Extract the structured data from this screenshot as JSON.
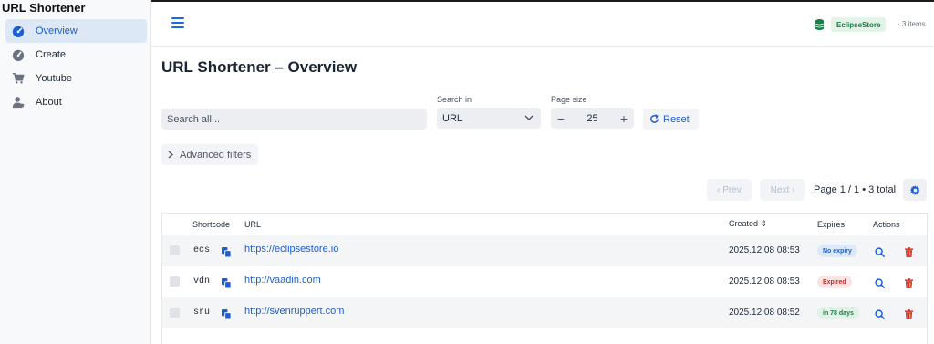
{
  "app": {
    "title": "URL Shortener"
  },
  "sidebar": {
    "items": [
      {
        "label": "Overview",
        "icon": "dashboard-icon",
        "active": true
      },
      {
        "label": "Create",
        "icon": "gauge-icon"
      },
      {
        "label": "Youtube",
        "icon": "cart-icon"
      },
      {
        "label": "About",
        "icon": "user-icon"
      }
    ]
  },
  "header": {
    "store_label": "EclipseStore",
    "items_count": "· 3 items"
  },
  "main": {
    "title": "URL Shortener – Overview"
  },
  "filters": {
    "search_placeholder": "Search all...",
    "search_in_label": "Search in",
    "search_in_value": "URL",
    "page_size_label": "Page size",
    "page_size_value": "25",
    "minus": "−",
    "plus": "+",
    "reset_label": "Reset",
    "advanced_label": "Advanced filters"
  },
  "pagination": {
    "prev_label": "‹ Prev",
    "next_label": "Next ›",
    "info": "Page 1 / 1 • 3 total"
  },
  "table": {
    "headers": {
      "shortcode": "Shortcode",
      "url": "URL",
      "created": "Created ⇕",
      "expires": "Expires",
      "actions": "Actions"
    },
    "rows": [
      {
        "shortcode": "ecs",
        "url": "https://eclipsestore.io",
        "created": "2025.12.08 08:53",
        "expires": "No expiry",
        "status": "none"
      },
      {
        "shortcode": "vdn",
        "url": "http://vaadin.com",
        "created": "2025.12.08 08:53",
        "expires": "Expired",
        "status": "expired"
      },
      {
        "shortcode": "sru",
        "url": "http://svenruppert.com",
        "created": "2025.12.08 08:52",
        "expires": "in 78 days",
        "status": "active"
      }
    ]
  },
  "colors": {
    "accent": "#1d5fd0",
    "delete": "#d92d20",
    "store_green": "#1a7f46"
  }
}
